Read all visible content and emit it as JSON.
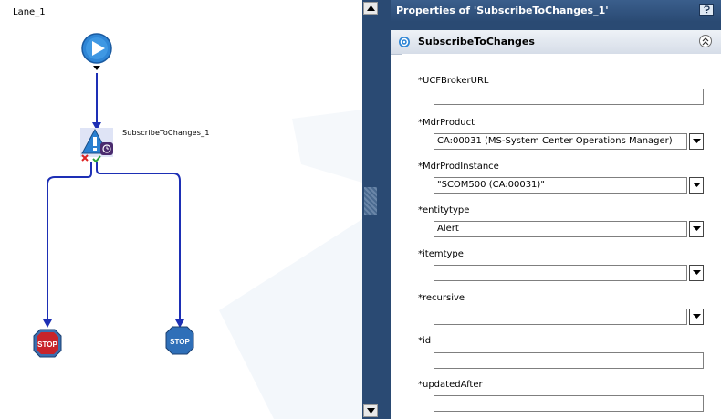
{
  "canvas": {
    "lane_label": "Lane_1",
    "node_label": "SubscribeToChanges_1",
    "stop_left_label": "STOP",
    "stop_right_label": "STOP"
  },
  "properties": {
    "title": "Properties of 'SubscribeToChanges_1'",
    "section_title": "SubscribeToChanges",
    "fields": {
      "ucf_broker_url": {
        "label": "*UCFBrokerURL",
        "value": ""
      },
      "mdr_product": {
        "label": "*MdrProduct",
        "value": "CA:00031 (MS-System Center Operations Manager)"
      },
      "mdr_prod_instance": {
        "label": "*MdrProdInstance",
        "value": "\"SCOM500 (CA:00031)\""
      },
      "entitytype": {
        "label": "*entitytype",
        "value": "Alert"
      },
      "itemtype": {
        "label": "*itemtype",
        "value": ""
      },
      "recursive": {
        "label": "*recursive",
        "value": ""
      },
      "id": {
        "label": "*id",
        "value": ""
      },
      "updated_after": {
        "label": "*updatedAfter",
        "value": ""
      }
    }
  },
  "colors": {
    "panel_bg": "#2a4a73",
    "flow_line": "#1d2fb5",
    "stop_red": "#c8242b",
    "stop_blue": "#2f6fb8"
  }
}
